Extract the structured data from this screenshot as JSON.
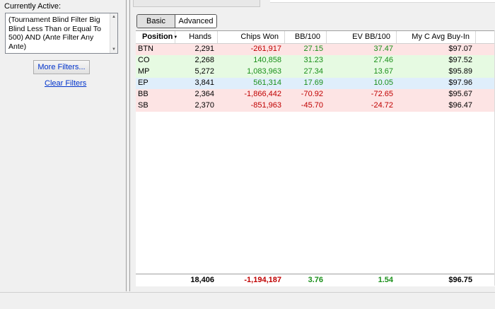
{
  "filters": {
    "label": "Currently Active:",
    "text": "(Tournament Blind Filter Big Blind Less Than or Equal To 500) AND (Ante Filter Any Ante)",
    "more_label": "More Filters...",
    "clear_label": "Clear Filters"
  },
  "view_toggle": {
    "basic": "Basic",
    "advanced": "Advanced",
    "selected": "Basic"
  },
  "table": {
    "columns": [
      "Position",
      "Hands",
      "Chips Won",
      "BB/100",
      "EV BB/100",
      "My C Avg Buy-In"
    ],
    "rows": [
      {
        "position": "BTN",
        "hands": "2,291",
        "chips_won": "-261,917",
        "bb100": "27.15",
        "ev_bb100": "37.47",
        "avg_buyin": "$97.07",
        "bg": "#fde4e4"
      },
      {
        "position": "CO",
        "hands": "2,268",
        "chips_won": "140,858",
        "bb100": "31.23",
        "ev_bb100": "27.46",
        "avg_buyin": "$97.52",
        "bg": "#e6fae2"
      },
      {
        "position": "MP",
        "hands": "5,272",
        "chips_won": "1,083,963",
        "bb100": "27.34",
        "ev_bb100": "13.67",
        "avg_buyin": "$95.89",
        "bg": "#e6fae2"
      },
      {
        "position": "EP",
        "hands": "3,841",
        "chips_won": "561,314",
        "bb100": "17.69",
        "ev_bb100": "10.05",
        "avg_buyin": "$97.96",
        "bg": "#dfeefb"
      },
      {
        "position": "BB",
        "hands": "2,364",
        "chips_won": "-1,866,442",
        "bb100": "-70.92",
        "ev_bb100": "-72.65",
        "avg_buyin": "$95.67",
        "bg": "#fde4e4"
      },
      {
        "position": "SB",
        "hands": "2,370",
        "chips_won": "-851,963",
        "bb100": "-45.70",
        "ev_bb100": "-24.72",
        "avg_buyin": "$96.47",
        "bg": "#fde4e4"
      }
    ],
    "totals": {
      "hands": "18,406",
      "chips_won": "-1,194,187",
      "bb100": "3.76",
      "ev_bb100": "1.54",
      "avg_buyin": "$96.75"
    }
  },
  "colors": {
    "positive": "#1a8f1a",
    "negative": "#c00000",
    "link": "#0033cc"
  }
}
